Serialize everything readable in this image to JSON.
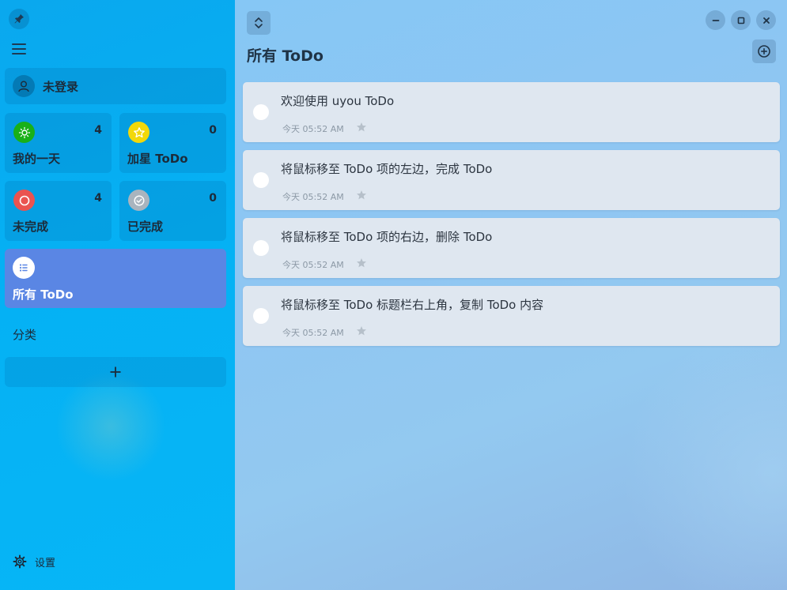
{
  "sidebar": {
    "user_label": "未登录",
    "tiles": {
      "my_day": {
        "label": "我的一天",
        "count": "4",
        "color": "#19b018"
      },
      "starred": {
        "label": "加星 ToDo",
        "count": "0",
        "color": "#f2d80a"
      },
      "unfinished": {
        "label": "未完成",
        "count": "4",
        "color": "#ea5350"
      },
      "finished": {
        "label": "已完成",
        "count": "0",
        "color": "#a9b4be"
      },
      "all": {
        "label": "所有 ToDo"
      }
    },
    "category_label": "分类",
    "add_category_symbol": "+",
    "settings_label": "设置"
  },
  "main": {
    "title": "所有 ToDo",
    "todos": [
      {
        "text": "欢迎使用 uyou ToDo",
        "time": "今天 05:52 AM"
      },
      {
        "text": "将鼠标移至 ToDo 项的左边，完成 ToDo",
        "time": "今天 05:52 AM"
      },
      {
        "text": "将鼠标移至 ToDo 项的右边，删除 ToDo",
        "time": "今天 05:52 AM"
      },
      {
        "text": "将鼠标移至 ToDo 标题栏右上角，复制 ToDo 内容",
        "time": "今天 05:52 AM"
      }
    ]
  },
  "icons": {
    "pin": "pin-icon",
    "menu": "hamburger-menu-icon",
    "user": "user-icon",
    "sun": "sun-icon",
    "star": "star-icon",
    "circle": "circle-icon",
    "check": "check-circle-icon",
    "list": "list-icon",
    "plus": "plus-icon",
    "gear": "gear-icon",
    "sort": "sort-icon",
    "minimize": "minimize-icon",
    "maximize": "maximize-icon",
    "close": "close-icon",
    "add": "add-circle-icon"
  }
}
